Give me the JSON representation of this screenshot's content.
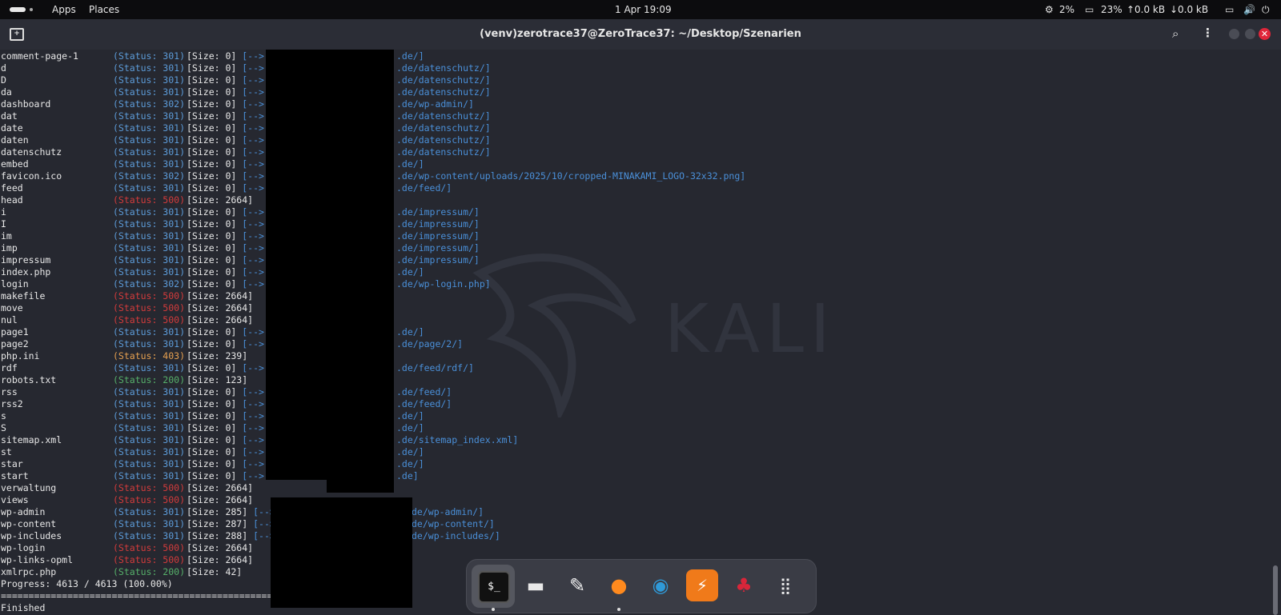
{
  "topbar": {
    "apps": "Apps",
    "places": "Places",
    "datetime": "1 Apr  19:09",
    "cpu": "2%",
    "mem": "23%",
    "up": "0.0 kB",
    "down": "0.0 kB"
  },
  "window": {
    "title": "(venv)zerotrace37@ZeroTrace37: ~/Desktop/Szenarien"
  },
  "lines": [
    {
      "name": "comment-page-1",
      "status": "301",
      "size": "0",
      "redir": ".de/]"
    },
    {
      "name": "d",
      "status": "301",
      "size": "0",
      "redir": ".de/datenschutz/]"
    },
    {
      "name": "D",
      "status": "301",
      "size": "0",
      "redir": ".de/datenschutz/]"
    },
    {
      "name": "da",
      "status": "301",
      "size": "0",
      "redir": ".de/datenschutz/]"
    },
    {
      "name": "dashboard",
      "status": "302",
      "size": "0",
      "redir": ".de/wp-admin/]"
    },
    {
      "name": "dat",
      "status": "301",
      "size": "0",
      "redir": ".de/datenschutz/]"
    },
    {
      "name": "date",
      "status": "301",
      "size": "0",
      "redir": ".de/datenschutz/]"
    },
    {
      "name": "daten",
      "status": "301",
      "size": "0",
      "redir": ".de/datenschutz/]"
    },
    {
      "name": "datenschutz",
      "status": "301",
      "size": "0",
      "redir": ".de/datenschutz/]"
    },
    {
      "name": "embed",
      "status": "301",
      "size": "0",
      "redir": ".de/]"
    },
    {
      "name": "favicon.ico",
      "status": "302",
      "size": "0",
      "redir": ".de/wp-content/uploads/2025/10/cropped-MINAKAMI_LOGO-32x32.png]"
    },
    {
      "name": "feed",
      "status": "301",
      "size": "0",
      "redir": ".de/feed/]"
    },
    {
      "name": "head",
      "status": "500",
      "size": "2664",
      "redir": ""
    },
    {
      "name": "i",
      "status": "301",
      "size": "0",
      "redir": ".de/impressum/]"
    },
    {
      "name": "I",
      "status": "301",
      "size": "0",
      "redir": ".de/impressum/]"
    },
    {
      "name": "im",
      "status": "301",
      "size": "0",
      "redir": ".de/impressum/]"
    },
    {
      "name": "imp",
      "status": "301",
      "size": "0",
      "redir": ".de/impressum/]"
    },
    {
      "name": "impressum",
      "status": "301",
      "size": "0",
      "redir": ".de/impressum/]"
    },
    {
      "name": "index.php",
      "status": "301",
      "size": "0",
      "redir": ".de/]"
    },
    {
      "name": "login",
      "status": "302",
      "size": "0",
      "redir": ".de/wp-login.php]"
    },
    {
      "name": "makefile",
      "status": "500",
      "size": "2664",
      "redir": ""
    },
    {
      "name": "move",
      "status": "500",
      "size": "2664",
      "redir": ""
    },
    {
      "name": "nul",
      "status": "500",
      "size": "2664",
      "redir": ""
    },
    {
      "name": "page1",
      "status": "301",
      "size": "0",
      "redir": ".de/]"
    },
    {
      "name": "page2",
      "status": "301",
      "size": "0",
      "redir": ".de/page/2/]"
    },
    {
      "name": "php.ini",
      "status": "403",
      "size": "239",
      "redir": ""
    },
    {
      "name": "rdf",
      "status": "301",
      "size": "0",
      "redir": ".de/feed/rdf/]"
    },
    {
      "name": "robots.txt",
      "status": "200",
      "size": "123",
      "redir": ""
    },
    {
      "name": "rss",
      "status": "301",
      "size": "0",
      "redir": ".de/feed/]"
    },
    {
      "name": "rss2",
      "status": "301",
      "size": "0",
      "redir": ".de/feed/]"
    },
    {
      "name": "s",
      "status": "301",
      "size": "0",
      "redir": ".de/]"
    },
    {
      "name": "S",
      "status": "301",
      "size": "0",
      "redir": ".de/]"
    },
    {
      "name": "sitemap.xml",
      "status": "301",
      "size": "0",
      "redir": ".de/sitemap_index.xml]"
    },
    {
      "name": "st",
      "status": "301",
      "size": "0",
      "redir": ".de/]"
    },
    {
      "name": "star",
      "status": "301",
      "size": "0",
      "redir": ".de/]"
    },
    {
      "name": "start",
      "status": "301",
      "size": "0",
      "redir": ".de]"
    },
    {
      "name": "verwaltung",
      "status": "500",
      "size": "2664",
      "redir": ""
    },
    {
      "name": "views",
      "status": "500",
      "size": "2664",
      "redir": ""
    },
    {
      "name": "wp-admin",
      "status": "301",
      "size": "285",
      "redir": "de/wp-admin/]",
      "alt": true
    },
    {
      "name": "wp-content",
      "status": "301",
      "size": "287",
      "redir": "de/wp-content/]",
      "alt": true
    },
    {
      "name": "wp-includes",
      "status": "301",
      "size": "288",
      "redir": "de/wp-includes/]",
      "alt": true
    },
    {
      "name": "wp-login",
      "status": "500",
      "size": "2664",
      "redir": ""
    },
    {
      "name": "wp-links-opml",
      "status": "500",
      "size": "2664",
      "redir": ""
    },
    {
      "name": "xmlrpc.php",
      "status": "200",
      "size": "42",
      "redir": ""
    }
  ],
  "progress": "Progress: 4613 / 4613 (100.00%)",
  "separator": "===============================================================",
  "finished": "Finished",
  "watermark": "KALI",
  "colors": {
    "redirect_status": "#5c9bd8",
    "error_status": "#d23b3b",
    "forbidden_status": "#e6a050",
    "ok_status": "#56b06a"
  },
  "dock": [
    "terminal-icon",
    "files-icon",
    "text-editor-icon",
    "firefox-icon",
    "wireshark-icon",
    "burpsuite-icon",
    "cherrytree-icon",
    "app-grid-icon"
  ]
}
